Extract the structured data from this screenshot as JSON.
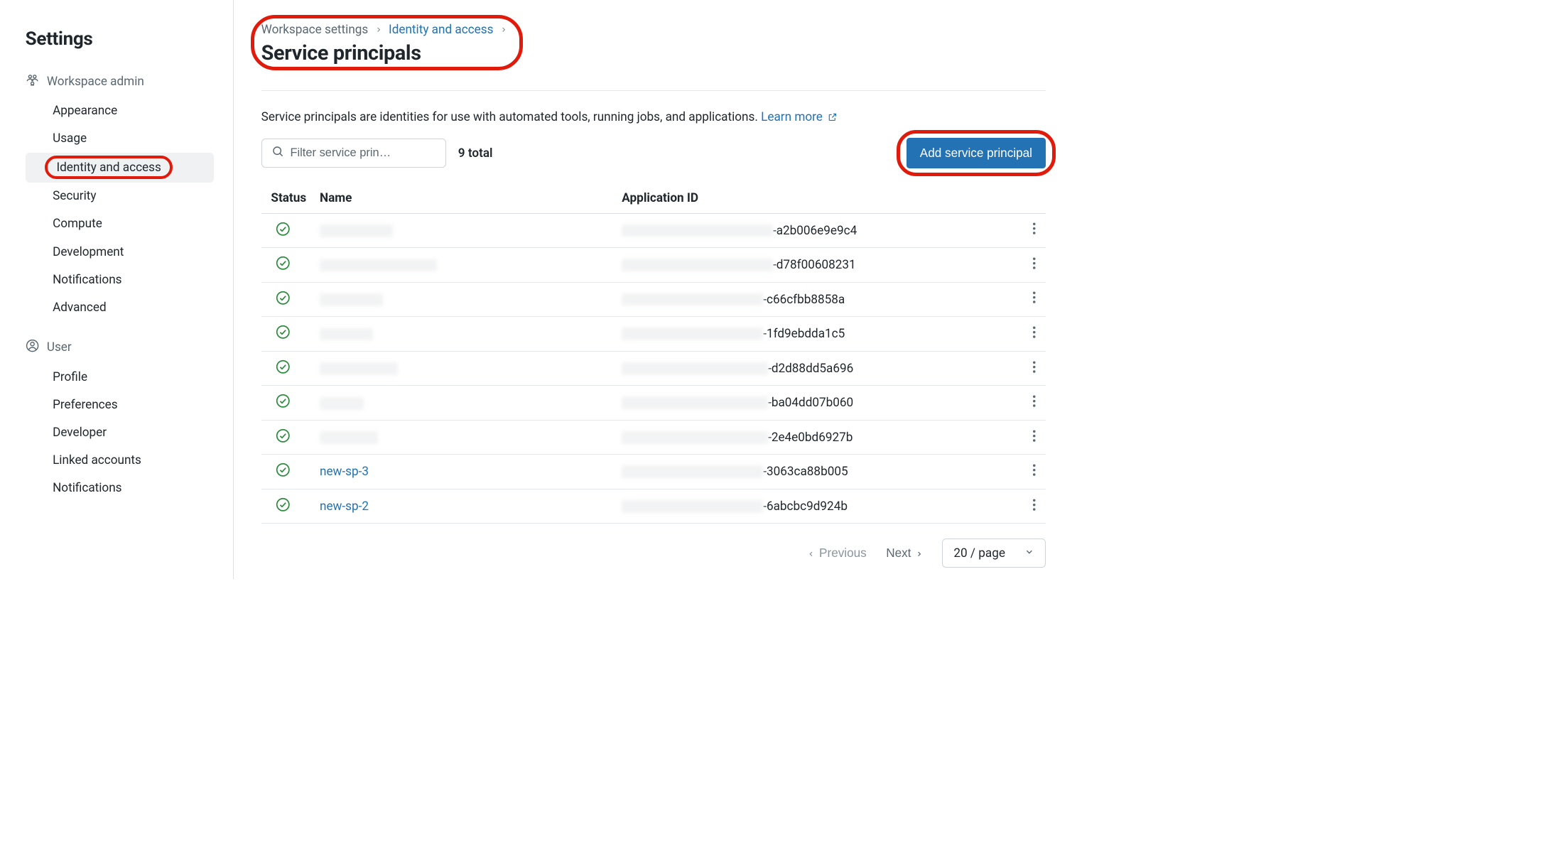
{
  "sidebar": {
    "title": "Settings",
    "sections": [
      {
        "header": "Workspace admin",
        "items": [
          {
            "label": "Appearance",
            "active": false
          },
          {
            "label": "Usage",
            "active": false
          },
          {
            "label": "Identity and access",
            "active": true,
            "highlighted": true
          },
          {
            "label": "Security",
            "active": false
          },
          {
            "label": "Compute",
            "active": false
          },
          {
            "label": "Development",
            "active": false
          },
          {
            "label": "Notifications",
            "active": false
          },
          {
            "label": "Advanced",
            "active": false
          }
        ]
      },
      {
        "header": "User",
        "items": [
          {
            "label": "Profile"
          },
          {
            "label": "Preferences"
          },
          {
            "label": "Developer"
          },
          {
            "label": "Linked accounts"
          },
          {
            "label": "Notifications"
          }
        ]
      }
    ]
  },
  "breadcrumbs": {
    "root": "Workspace settings",
    "parent": "Identity and access"
  },
  "page_title": "Service principals",
  "description": {
    "text": "Service principals are identities for use with automated tools, running jobs, and applications.",
    "learn_more": "Learn more"
  },
  "toolbar": {
    "search_placeholder": "Filter service prin…",
    "count_label": "9 total",
    "add_button": "Add service principal"
  },
  "table": {
    "columns": {
      "status": "Status",
      "name": "Name",
      "appid": "Application ID"
    },
    "rows": [
      {
        "name_blur_w": 150,
        "name": null,
        "appid_blur_w": 310,
        "appid_prefix": "",
        "appid_suffix": "-a2b006e9e9c4"
      },
      {
        "name_blur_w": 240,
        "name": null,
        "appid_blur_w": 310,
        "appid_prefix": "",
        "appid_suffix": "-d78f00608231"
      },
      {
        "name_blur_w": 130,
        "name": null,
        "appid_blur_w": 290,
        "appid_prefix": "",
        "appid_suffix": "-c66cfbb8858a"
      },
      {
        "name_blur_w": 110,
        "name": null,
        "appid_blur_w": 290,
        "appid_prefix": "",
        "appid_suffix": "-1fd9ebdda1c5"
      },
      {
        "name_blur_w": 160,
        "name": null,
        "appid_blur_w": 300,
        "appid_prefix": "",
        "appid_suffix": "-d2d88dd5a696"
      },
      {
        "name_blur_w": 90,
        "name": null,
        "appid_blur_w": 300,
        "appid_prefix": "",
        "appid_suffix": "-ba04dd07b060"
      },
      {
        "name_blur_w": 120,
        "name": null,
        "appid_blur_w": 300,
        "appid_prefix": "",
        "appid_suffix": "-2e4e0bd6927b"
      },
      {
        "name_blur_w": 0,
        "name": "new-sp-3",
        "appid_blur_w": 290,
        "appid_prefix": "",
        "appid_suffix": "-3063ca88b005"
      },
      {
        "name_blur_w": 0,
        "name": "new-sp-2",
        "appid_blur_w": 290,
        "appid_prefix": "",
        "appid_suffix": "-6abcbc9d924b"
      }
    ]
  },
  "pager": {
    "prev": "Previous",
    "next": "Next",
    "page_size": "20 / page"
  }
}
